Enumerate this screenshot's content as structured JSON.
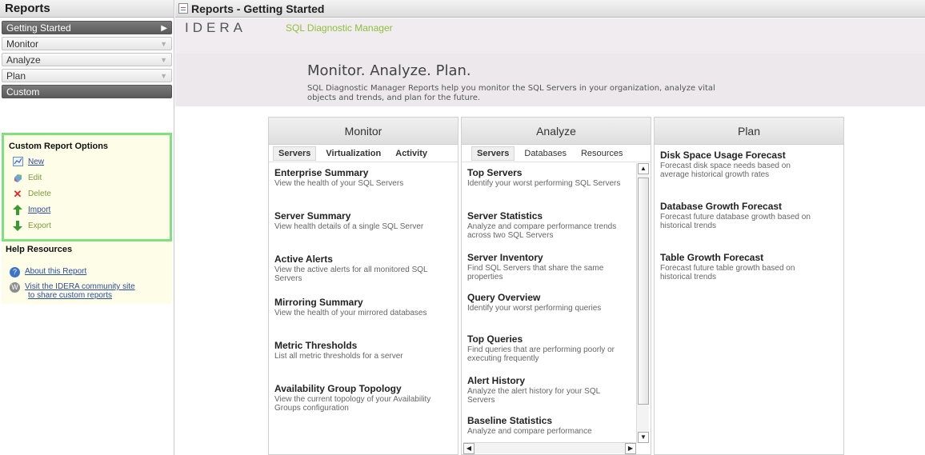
{
  "sidebar": {
    "title": "Reports",
    "nav": [
      {
        "label": "Getting Started",
        "arrow": "▶"
      },
      {
        "label": "Monitor",
        "arrow": "▼"
      },
      {
        "label": "Analyze",
        "arrow": "▼"
      },
      {
        "label": "Plan",
        "arrow": "▼"
      },
      {
        "label": "Custom",
        "arrow": ""
      }
    ],
    "options": {
      "title": "Custom Report Options",
      "items": [
        {
          "label": "New",
          "icon": "chart-icon"
        },
        {
          "label": "Edit",
          "icon": "edit-icon"
        },
        {
          "label": "Delete",
          "icon": "delete-icon"
        },
        {
          "label": "Import",
          "icon": "arrow-up-icon"
        },
        {
          "label": "Export",
          "icon": "arrow-down-icon"
        }
      ]
    },
    "help": {
      "title": "Help Resources",
      "about": "About this Report",
      "community_line1": "Visit the IDERA community site",
      "community_line2": "to share custom reports"
    }
  },
  "main": {
    "title": "Reports - Getting Started",
    "logo": "IDERA",
    "product": "SQL Diagnostic Manager",
    "heading": "Monitor. Analyze. Plan.",
    "desc_line1": "SQL Diagnostic Manager Reports help you monitor the SQL Servers in your organization, analyze vital",
    "desc_line2": "objects and trends, and plan for the future."
  },
  "panels": {
    "monitor": {
      "header": "Monitor",
      "tabs": [
        "Servers",
        "Virtualization",
        "Activity"
      ],
      "reports": [
        {
          "title": "Enterprise Summary",
          "desc": [
            "View the health of your SQL Servers"
          ]
        },
        {
          "title": "Server Summary",
          "desc": [
            "View health details of a single SQL Server"
          ]
        },
        {
          "title": "Active Alerts",
          "desc": [
            "View the active alerts for all monitored SQL",
            "Servers"
          ]
        },
        {
          "title": "Mirroring Summary",
          "desc": [
            "View the health of your mirrored databases"
          ]
        },
        {
          "title": "Metric Thresholds",
          "desc": [
            "List all metric thresholds for a server"
          ]
        },
        {
          "title": "Availability Group Topology",
          "desc": [
            "View the current topology of your Availability",
            "Groups configuration"
          ]
        }
      ]
    },
    "analyze": {
      "header": "Analyze",
      "tabs": [
        "Servers",
        "Databases",
        "Resources"
      ],
      "reports": [
        {
          "title": "Top Servers",
          "desc": [
            "Identify your worst performing SQL Servers"
          ]
        },
        {
          "title": "Server Statistics",
          "desc": [
            "Analyze and compare performance trends",
            "across two SQL Servers"
          ]
        },
        {
          "title": "Server Inventory",
          "desc": [
            "Find SQL Servers that share the same",
            "properties"
          ]
        },
        {
          "title": "Query Overview",
          "desc": [
            "Identify your worst performing queries"
          ]
        },
        {
          "title": "Top Queries",
          "desc": [
            "Find queries that are performing poorly or",
            "executing frequently"
          ]
        },
        {
          "title": "Alert History",
          "desc": [
            "Analyze the alert history for your SQL",
            "Servers"
          ]
        },
        {
          "title": "Baseline Statistics",
          "desc": [
            "Analyze and compare performance"
          ]
        }
      ]
    },
    "plan": {
      "header": "Plan",
      "reports": [
        {
          "title": "Disk Space Usage Forecast",
          "desc": [
            "Forecast disk space needs based on",
            "average historical growth rates"
          ]
        },
        {
          "title": "Database Growth Forecast",
          "desc": [
            "Forecast future database growth based on",
            "historical trends"
          ]
        },
        {
          "title": "Table Growth Forecast",
          "desc": [
            "Forecast future table growth based on",
            "historical trends"
          ]
        }
      ]
    }
  }
}
